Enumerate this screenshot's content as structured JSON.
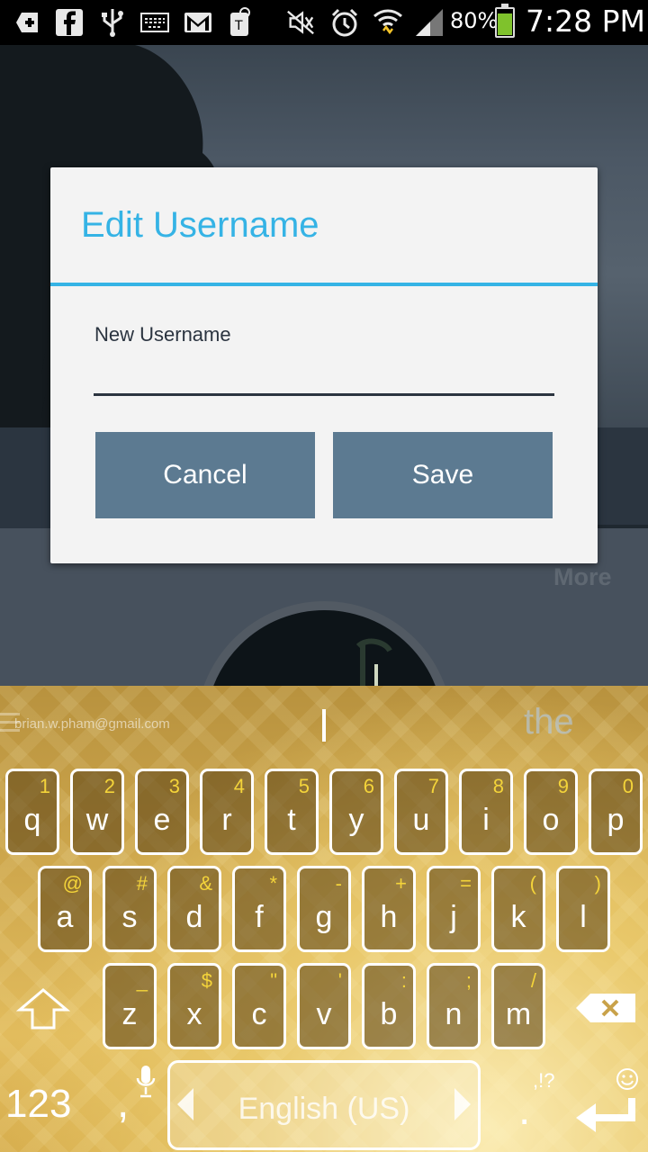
{
  "status_bar": {
    "icons": [
      "add-notification-icon",
      "facebook-icon",
      "usb-icon",
      "keyboard-icon",
      "gmail-icon",
      "tmobile-icon",
      "silent-mode-icon",
      "alarm-icon",
      "wifi-icon",
      "signal-icon"
    ],
    "battery_percent": "80%",
    "battery_level": 0.8,
    "time": "7:28 PM"
  },
  "background_app": {
    "more_label": "More"
  },
  "dialog": {
    "title": "Edit Username",
    "field_label": "New Username",
    "field_value": "",
    "cancel_label": "Cancel",
    "save_label": "Save",
    "accent_color": "#35b3e5",
    "button_color": "#5c7a91"
  },
  "keyboard": {
    "suggestion_email": "brian.w.pham@gmail.com",
    "suggestion_word": "the",
    "rows": [
      [
        {
          "main": "q",
          "sub": "1"
        },
        {
          "main": "w",
          "sub": "2"
        },
        {
          "main": "e",
          "sub": "3"
        },
        {
          "main": "r",
          "sub": "4"
        },
        {
          "main": "t",
          "sub": "5"
        },
        {
          "main": "y",
          "sub": "6"
        },
        {
          "main": "u",
          "sub": "7"
        },
        {
          "main": "i",
          "sub": "8"
        },
        {
          "main": "o",
          "sub": "9"
        },
        {
          "main": "p",
          "sub": "0"
        }
      ],
      [
        {
          "main": "a",
          "sub": "@"
        },
        {
          "main": "s",
          "sub": "#"
        },
        {
          "main": "d",
          "sub": "&"
        },
        {
          "main": "f",
          "sub": "*"
        },
        {
          "main": "g",
          "sub": "-"
        },
        {
          "main": "h",
          "sub": "+"
        },
        {
          "main": "j",
          "sub": "="
        },
        {
          "main": "k",
          "sub": "("
        },
        {
          "main": "l",
          "sub": ")"
        }
      ],
      [
        {
          "main": "z",
          "sub": "_"
        },
        {
          "main": "x",
          "sub": "$"
        },
        {
          "main": "c",
          "sub": "\""
        },
        {
          "main": "v",
          "sub": "'"
        },
        {
          "main": "b",
          "sub": ":"
        },
        {
          "main": "n",
          "sub": ";"
        },
        {
          "main": "m",
          "sub": "/"
        }
      ]
    ],
    "symbols_label": "123",
    "comma_label": ",",
    "space_label": "English (US)",
    "period_label": ".",
    "punct_label": ",!?"
  }
}
